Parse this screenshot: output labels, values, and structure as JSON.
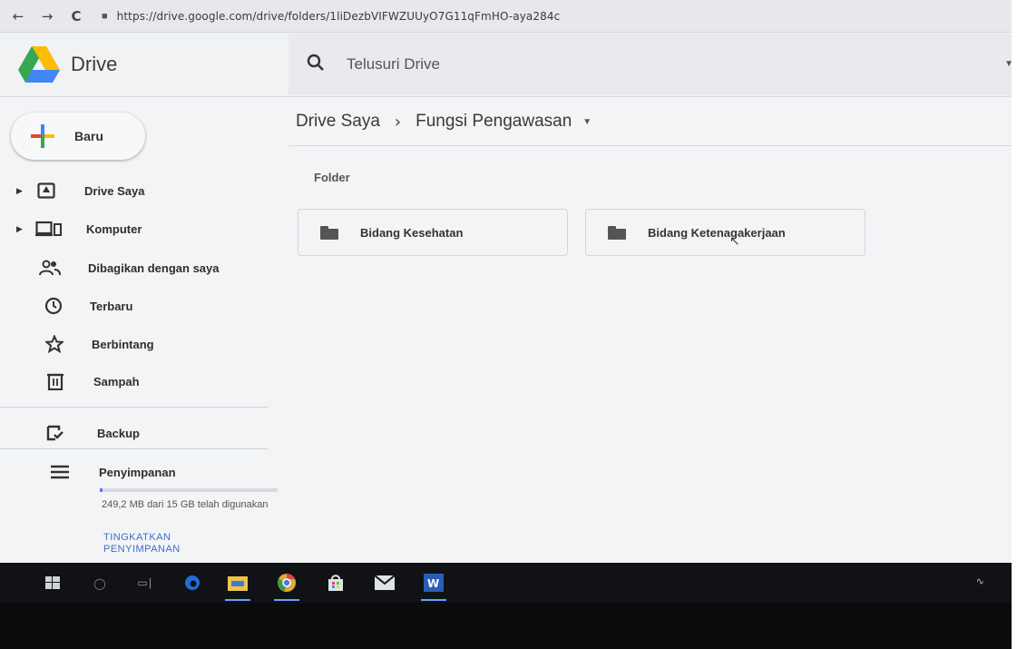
{
  "browser": {
    "url": "https://drive.google.com/drive/folders/1liDezbVIFWZUUyO7G11qFmHO-aya284c",
    "back_icon": "←",
    "forward_icon": "→",
    "reload_icon": "C",
    "lock_icon": "🔒"
  },
  "header": {
    "app_title": "Drive",
    "search_placeholder": "Telusuri Drive",
    "search_icon": "⌕"
  },
  "sidebar": {
    "new_label": "Baru",
    "items": [
      {
        "label": "Drive Saya",
        "icon": "drive-icon"
      },
      {
        "label": "Komputer",
        "icon": "computer-icon"
      },
      {
        "label": "Dibagikan dengan saya",
        "icon": "shared-icon"
      },
      {
        "label": "Terbaru",
        "icon": "clock-icon"
      },
      {
        "label": "Berbintang",
        "icon": "star-icon"
      },
      {
        "label": "Sampah",
        "icon": "trash-icon"
      },
      {
        "label": "Backup",
        "icon": "backup-icon"
      },
      {
        "label": "Penyimpanan",
        "icon": "storage-icon"
      }
    ],
    "storage_used_fraction": 0.016,
    "storage_text": "249,2 MB dari 15 GB telah digunakan",
    "upgrade_label": "TINGKATKAN PENYIMPANAN"
  },
  "main": {
    "breadcrumb_root": "Drive Saya",
    "breadcrumb_sep": "›",
    "breadcrumb_current": "Fungsi Pengawasan",
    "section_label": "Folder",
    "folders": [
      {
        "name": "Bidang Kesehatan"
      },
      {
        "name": "Bidang Ketenagakerjaan"
      }
    ]
  },
  "colors": {
    "accent_blue": "#4285f4",
    "plus_red": "#ea4335",
    "plus_yellow": "#fbbc05",
    "plus_green": "#34a853",
    "taskbar": "#101216"
  }
}
